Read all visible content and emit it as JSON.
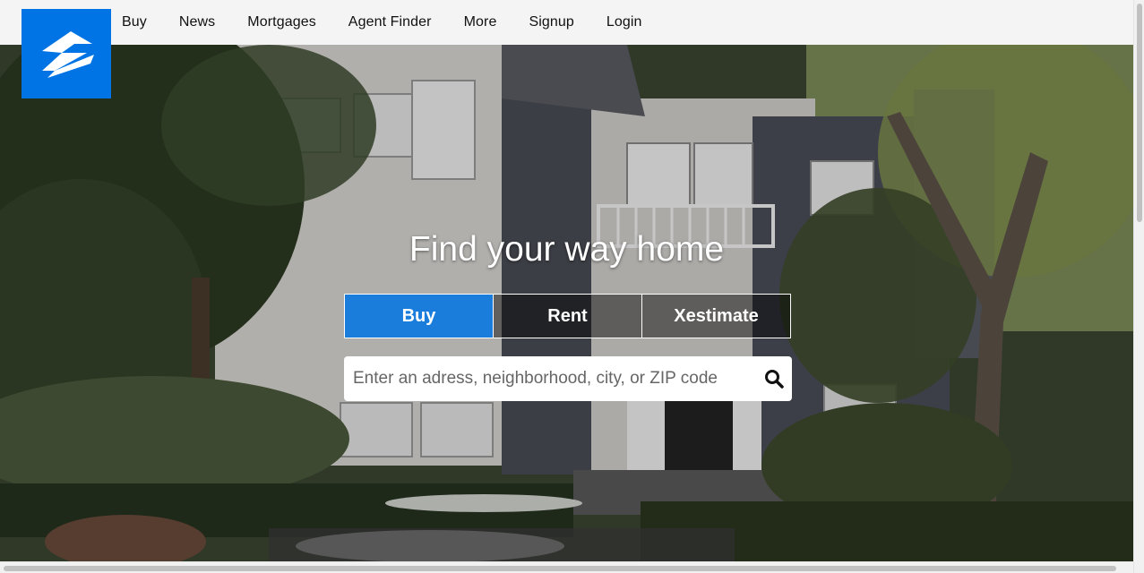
{
  "nav": {
    "logo": "zillow-logo-icon",
    "items": [
      "Buy",
      "News",
      "Mortgages",
      "Agent Finder",
      "More",
      "Signup",
      "Login"
    ]
  },
  "hero": {
    "headline": "Find your way home",
    "tabs": [
      {
        "label": "Buy",
        "active": true
      },
      {
        "label": "Rent",
        "active": false
      },
      {
        "label": "Xestimate",
        "active": false
      }
    ],
    "search": {
      "placeholder": "Enter an adress, neighborhood, city, or ZIP code",
      "icon": "search-icon"
    }
  },
  "colors": {
    "brand": "#0074e4",
    "nav_bg": "#f4f4f4"
  }
}
